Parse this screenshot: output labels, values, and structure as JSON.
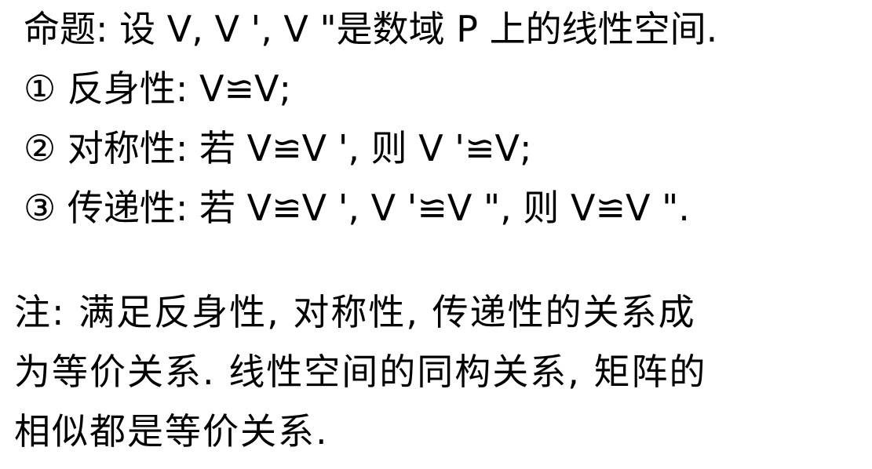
{
  "proposition": {
    "line1": "命题: 设 V, V ', V \"是数域 P 上的线性空间.",
    "item1": "① 反身性: V≌V;",
    "item2": "② 对称性: 若 V≌V ', 则 V '≌V;",
    "item3": "③ 传递性: 若 V≌V ', V '≌V \", 则 V≌V \"."
  },
  "note": {
    "line1": "注: 满足反身性, 对称性, 传递性的关系成",
    "line2": "为等价关系. 线性空间的同构关系, 矩阵的",
    "line3": "相似都是等价关系."
  }
}
